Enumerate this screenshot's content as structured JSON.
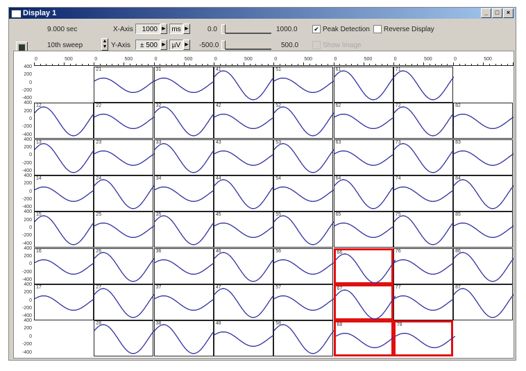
{
  "window": {
    "title": "Display 1",
    "min": "_",
    "max": "□",
    "close": "×"
  },
  "toolbar": {
    "time": "9.000 sec",
    "sweep": "10th sweep",
    "xaxis_label": "X-Axis",
    "xaxis_value": "1000",
    "xaxis_unit": "ms",
    "yaxis_label": "Y-Axis",
    "yaxis_value": "± 500",
    "yaxis_unit": "µV",
    "x_min": "0.0",
    "x_max": "1000.0",
    "y_min": "-500.0",
    "y_max": "500.0",
    "peak_detection": "Peak Detection",
    "peak_detection_checked": true,
    "reverse_display": "Reverse Display",
    "reverse_display_checked": false,
    "show_image": "Show Image",
    "show_image_checked": false
  },
  "axes": {
    "x_ticks": [
      "0",
      "500"
    ],
    "y_ticks": [
      "400",
      "200",
      "0",
      "-200",
      "-400"
    ]
  },
  "colors": {
    "trace": "#3030a0",
    "highlight": "#e01010"
  },
  "grid": {
    "rows": [
      [
        null,
        {
          "label": "21",
          "amp": 200
        },
        {
          "label": "31",
          "amp": 200
        },
        {
          "label": "41",
          "amp": 400
        },
        {
          "label": "51",
          "amp": 200
        },
        {
          "label": "61",
          "amp": 400
        },
        {
          "label": "71",
          "amp": 400
        },
        null
      ],
      [
        {
          "label": "12",
          "amp": 400
        },
        {
          "label": "22",
          "amp": 200
        },
        {
          "label": "32",
          "amp": 400
        },
        {
          "label": "42",
          "amp": 200
        },
        {
          "label": "52",
          "amp": 400
        },
        {
          "label": "62",
          "amp": 200
        },
        {
          "label": "72",
          "amp": 400
        },
        {
          "label": "82",
          "amp": 200
        }
      ],
      [
        {
          "label": "13",
          "amp": 400
        },
        {
          "label": "23",
          "amp": 200
        },
        {
          "label": "33",
          "amp": 400
        },
        {
          "label": "43",
          "amp": 200
        },
        {
          "label": "53",
          "amp": 400
        },
        {
          "label": "63",
          "amp": 200
        },
        {
          "label": "73",
          "amp": 400
        },
        {
          "label": "83",
          "amp": 200
        }
      ],
      [
        {
          "label": "14",
          "amp": 200
        },
        {
          "label": "24",
          "amp": 400
        },
        {
          "label": "34",
          "amp": 200
        },
        {
          "label": "44",
          "amp": 400
        },
        {
          "label": "54",
          "amp": 200
        },
        {
          "label": "64",
          "amp": 400
        },
        {
          "label": "74",
          "amp": 200
        },
        {
          "label": "84",
          "amp": 400
        }
      ],
      [
        {
          "label": "15",
          "amp": 400
        },
        {
          "label": "25",
          "amp": 200
        },
        {
          "label": "35",
          "amp": 400
        },
        {
          "label": "45",
          "amp": 200
        },
        {
          "label": "55",
          "amp": 400
        },
        {
          "label": "65",
          "amp": 200
        },
        {
          "label": "75",
          "amp": 400
        },
        {
          "label": "85",
          "amp": 200
        }
      ],
      [
        {
          "label": "16",
          "amp": 200
        },
        {
          "label": "26",
          "amp": 400
        },
        {
          "label": "36",
          "amp": 200
        },
        {
          "label": "46",
          "amp": 400
        },
        {
          "label": "56",
          "amp": 200
        },
        {
          "label": "66",
          "amp": 400,
          "hl": true
        },
        {
          "label": "76",
          "amp": 200
        },
        {
          "label": "86",
          "amp": 400
        }
      ],
      [
        {
          "label": "17",
          "amp": 200
        },
        {
          "label": "27",
          "amp": 400
        },
        {
          "label": "37",
          "amp": 200
        },
        {
          "label": "47",
          "amp": 400
        },
        {
          "label": "57",
          "amp": 200
        },
        {
          "label": "67",
          "amp": 400,
          "hl": true
        },
        {
          "label": "77",
          "amp": 200
        },
        {
          "label": "87",
          "amp": 400
        }
      ],
      [
        null,
        {
          "label": "28",
          "amp": 400
        },
        {
          "label": "38",
          "amp": 400
        },
        {
          "label": "48",
          "amp": 200
        },
        {
          "label": "58",
          "amp": 400
        },
        {
          "label": "68",
          "amp": 200,
          "hl": true
        },
        {
          "label": "78",
          "amp": 200,
          "hl": true
        },
        null
      ]
    ]
  }
}
